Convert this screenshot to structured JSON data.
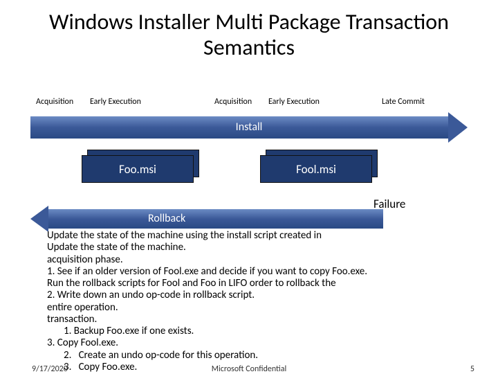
{
  "title": "Windows Installer Multi Package Transaction Semantics",
  "phases": {
    "acq1": "Acquisition",
    "exec1": "Early Execution",
    "acq2": "Acquisition",
    "exec2": "Early Execution",
    "late": "Late Commit"
  },
  "install_label": "Install",
  "rollback_label": "Rollback",
  "msi": {
    "foo": "Foo.msi",
    "fool": "Fool.msi"
  },
  "failure": "Failure",
  "overlay": {
    "l1": "Update the state of the machine using the install script created in",
    "l2": "Update the state of the machine.",
    "l3": "acquisition phase.",
    "l4": "1. See if an older version of Fool.exe and decide if you want to copy Foo.exe.",
    "l5": "Run the rollback scripts for Fool and Foo in LIFO order to rollback the",
    "l6": "2. Write down an undo op-code in rollback script.",
    "l7": "entire operation.",
    "l8": "transaction.",
    "l9": "1. Backup Foo.exe if one exists.",
    "l10": "3. Copy Fool.exe.",
    "l11": "2.   Create an undo op-code for this operation.",
    "l12": "3.   Copy Foo.exe."
  },
  "footer": {
    "date": "9/17/2020",
    "conf": "Microsoft Confidential",
    "page": "5"
  }
}
